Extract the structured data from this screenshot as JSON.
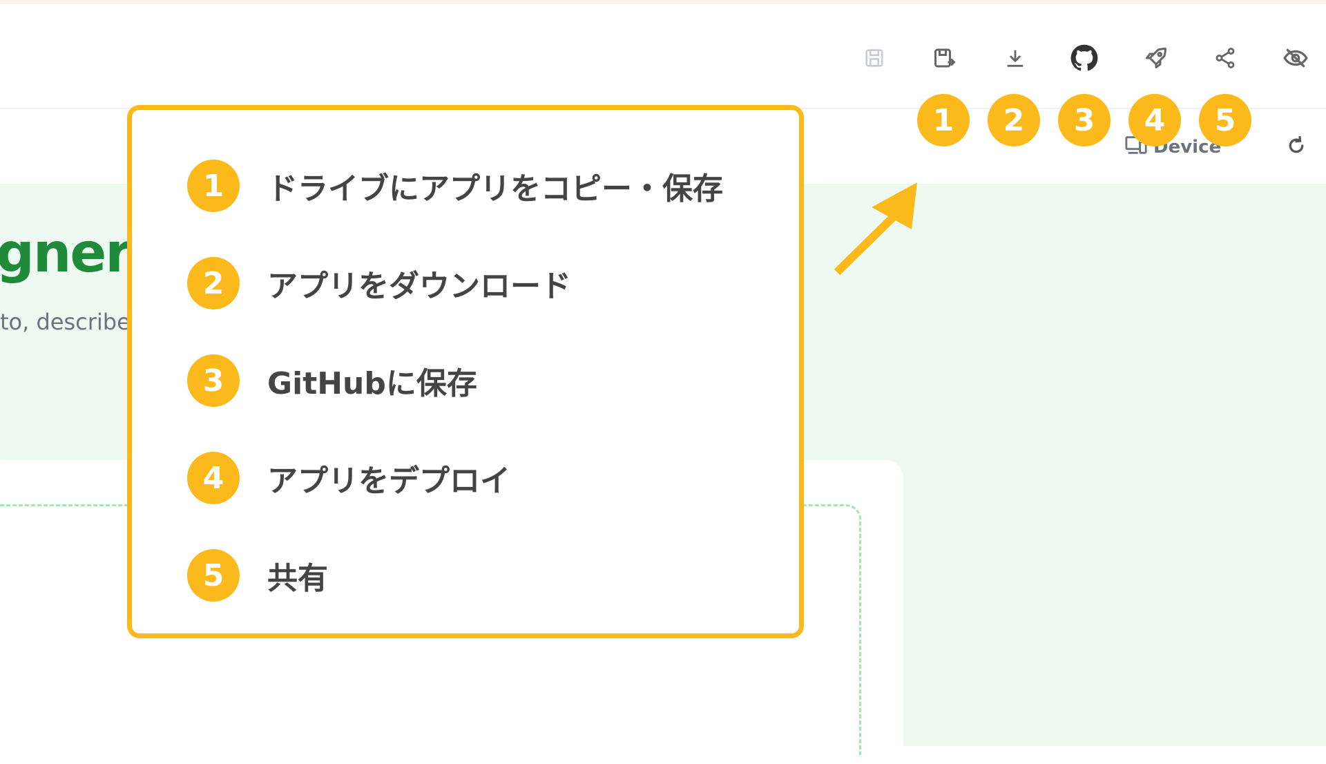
{
  "preview": {
    "title_fragment": "gner",
    "subtitle_fragment": "to, describe"
  },
  "toolbar": {
    "device_label": "Device",
    "icons": [
      "save-icon",
      "save-copy-icon",
      "download-icon",
      "github-icon",
      "rocket-icon",
      "share-icon",
      "hide-icon"
    ]
  },
  "badges": [
    "1",
    "2",
    "3",
    "4",
    "5"
  ],
  "legend": {
    "items": [
      {
        "num": "1",
        "text": "ドライブにアプリをコピー・保存"
      },
      {
        "num": "2",
        "text": "アプリをダウンロード"
      },
      {
        "num": "3",
        "text": "GitHubに保存"
      },
      {
        "num": "4",
        "text": "アプリをデプロイ"
      },
      {
        "num": "5",
        "text": "共有"
      }
    ]
  },
  "colors": {
    "accent": "#fbb91c",
    "preview_bg": "#eefaf1",
    "title_green": "#1e8a3a"
  }
}
